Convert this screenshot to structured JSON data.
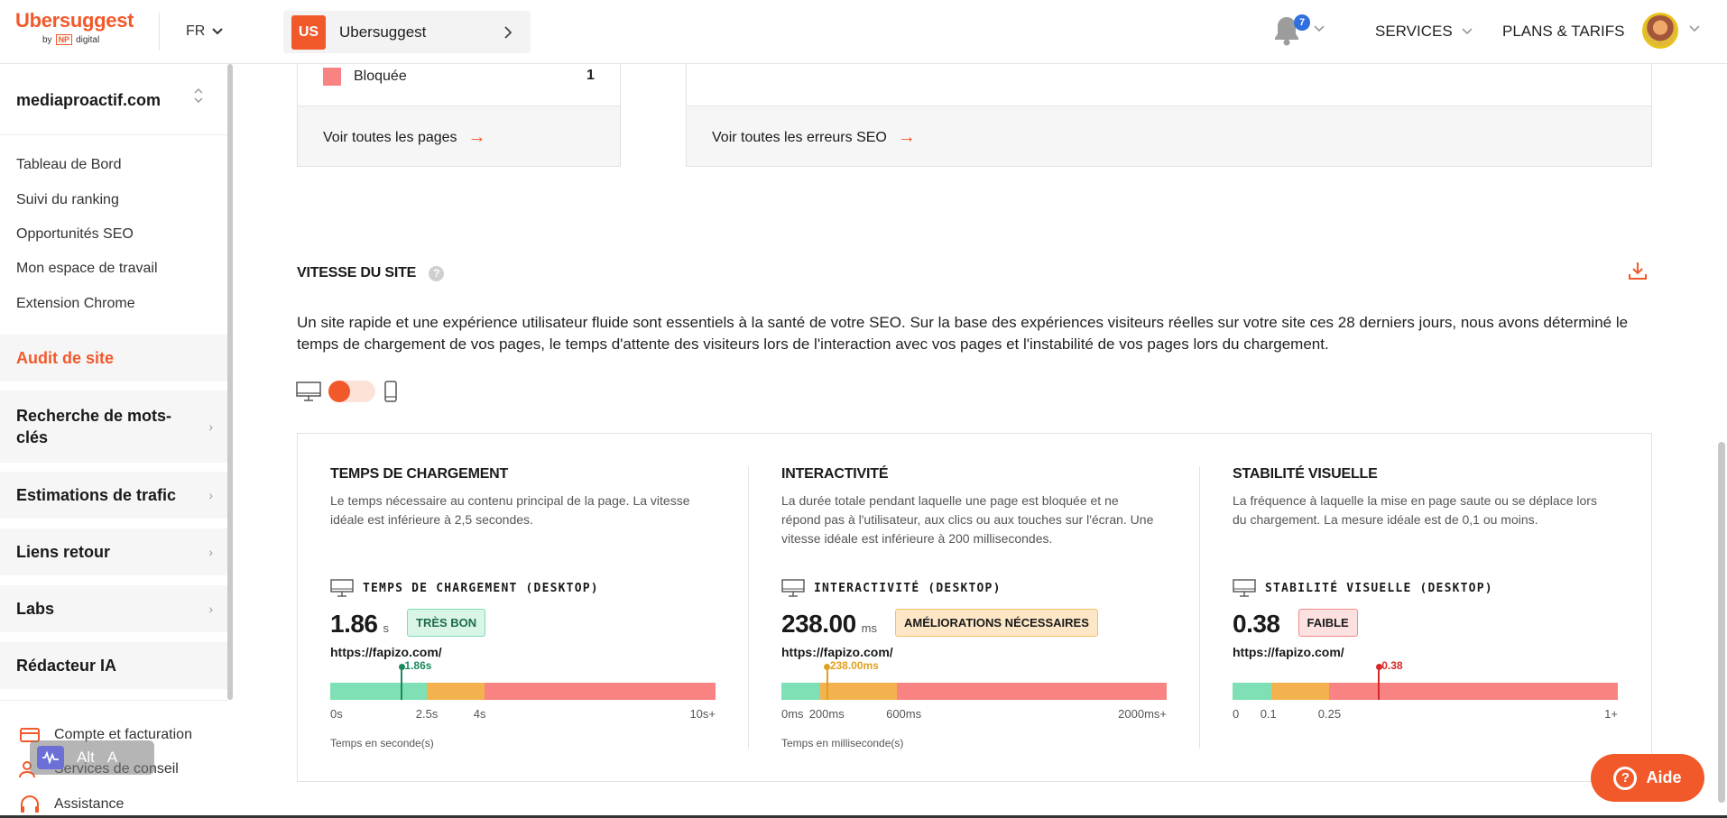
{
  "header": {
    "logo_text": "Ubersuggest",
    "logo_by": "by",
    "logo_np": "NP",
    "logo_digital": "digital",
    "language": "FR",
    "project_badge": "US",
    "project_name": "Ubersuggest",
    "notifications_count": "7",
    "nav_services": "SERVICES",
    "nav_plans": "PLANS & TARIFS"
  },
  "sidebar": {
    "site": "mediaproactif.com",
    "links": [
      "Tableau de Bord",
      "Suivi du ranking",
      "Opportunités SEO",
      "Mon espace de travail",
      "Extension Chrome"
    ],
    "active_item": "Audit de site",
    "sections": [
      "Recherche de mots-clés",
      "Estimations de trafic",
      "Liens retour",
      "Labs",
      "Rédacteur IA"
    ],
    "bottom": [
      "Compte et facturation",
      "Services de conseil",
      "Assistance"
    ],
    "overlay_alt": "Alt",
    "overlay_a": "A"
  },
  "top_cards": {
    "blocked_label": "Bloquée",
    "blocked_count": "1",
    "link_pages": "Voir toutes les pages",
    "link_errors": "Voir toutes les erreurs SEO",
    "colors": {
      "blocked": "#f98383"
    }
  },
  "speed": {
    "title": "VITESSE DU SITE",
    "description": "Un site rapide et une expérience utilisateur fluide sont essentiels à la santé de votre SEO. Sur la base des expériences visiteurs réelles sur votre site ces 28 derniers jours, nous avons déterminé le temps de chargement de vos pages, le temps d'attente des visiteurs lors de l'interaction avec vos pages et l'instabilité de vos pages lors du chargement.",
    "device_selected": "desktop",
    "metrics": [
      {
        "title": "TEMPS DE CHARGEMENT",
        "description": "Le temps nécessaire au contenu principal de la page. La vitesse idéale est inférieure à 2,5 secondes.",
        "subtitle": "TEMPS DE CHARGEMENT (DESKTOP)",
        "value": "1.86",
        "unit": "s",
        "badge": "TRÈS BON",
        "badge_bg": "#d8f5e8",
        "badge_border": "#7fdcb4",
        "badge_color": "#1d6b4a",
        "url": "https://fapizo.com/",
        "marker_label": "1.86s",
        "marker_color": "#1a8a5c",
        "marker_fraction": 0.186,
        "segments": [
          0.25,
          0.15,
          0.6
        ],
        "ticks": [
          {
            "label": "0s",
            "fraction": 0
          },
          {
            "label": "2.5s",
            "fraction": 0.25
          },
          {
            "label": "4s",
            "fraction": 0.4
          },
          {
            "label": "10s+",
            "fraction": 1
          }
        ],
        "axis_note": "Temps en seconde(s)"
      },
      {
        "title": "INTERACTIVITÉ",
        "description": "La durée totale pendant laquelle une page est bloquée et ne répond pas à l'utilisateur, aux clics ou aux touches sur l'écran. Une vitesse idéale est inférieure à 200 millisecondes.",
        "subtitle": "INTERACTIVITÉ (DESKTOP)",
        "value": "238.00",
        "unit": "ms",
        "badge": "AMÉLIORATIONS NÉCESSAIRES",
        "badge_bg": "#fde7c6",
        "badge_border": "#f3c06a",
        "badge_color": "#1a1a1a",
        "url": "https://fapizo.com/",
        "marker_label": "238.00ms",
        "marker_color": "#e0a020",
        "marker_fraction": 0.119,
        "segments": [
          0.1,
          0.2,
          0.7
        ],
        "ticks": [
          {
            "label": "0ms",
            "fraction": 0
          },
          {
            "label": "200ms",
            "fraction": 0.1
          },
          {
            "label": "600ms",
            "fraction": 0.3
          },
          {
            "label": "2000ms+",
            "fraction": 1
          }
        ],
        "axis_note": "Temps en milliseconde(s)"
      },
      {
        "title": "STABILITÉ VISUELLE",
        "description": "La fréquence à laquelle la mise en page saute ou se déplace lors du chargement. La mesure idéale est de 0,1 ou moins.",
        "subtitle": "STABILITÉ VISUELLE (DESKTOP)",
        "value": "0.38",
        "unit": "",
        "badge": "FAIBLE",
        "badge_bg": "#fde0e0",
        "badge_border": "#f38a8a",
        "badge_color": "#1a1a1a",
        "url": "https://fapizo.com/",
        "marker_label": "0.38",
        "marker_color": "#d62a2a",
        "marker_fraction": 0.38,
        "segments": [
          0.1,
          0.15,
          0.75
        ],
        "ticks": [
          {
            "label": "0",
            "fraction": 0
          },
          {
            "label": "0.1",
            "fraction": 0.1
          },
          {
            "label": "0.25",
            "fraction": 0.25
          },
          {
            "label": "1+",
            "fraction": 1
          }
        ],
        "axis_note": ""
      }
    ],
    "bar_colors": [
      "#7fe0b6",
      "#f3b24e",
      "#f98383"
    ]
  },
  "help_button": "Aide",
  "colors": {
    "accent": "#f2592a"
  }
}
